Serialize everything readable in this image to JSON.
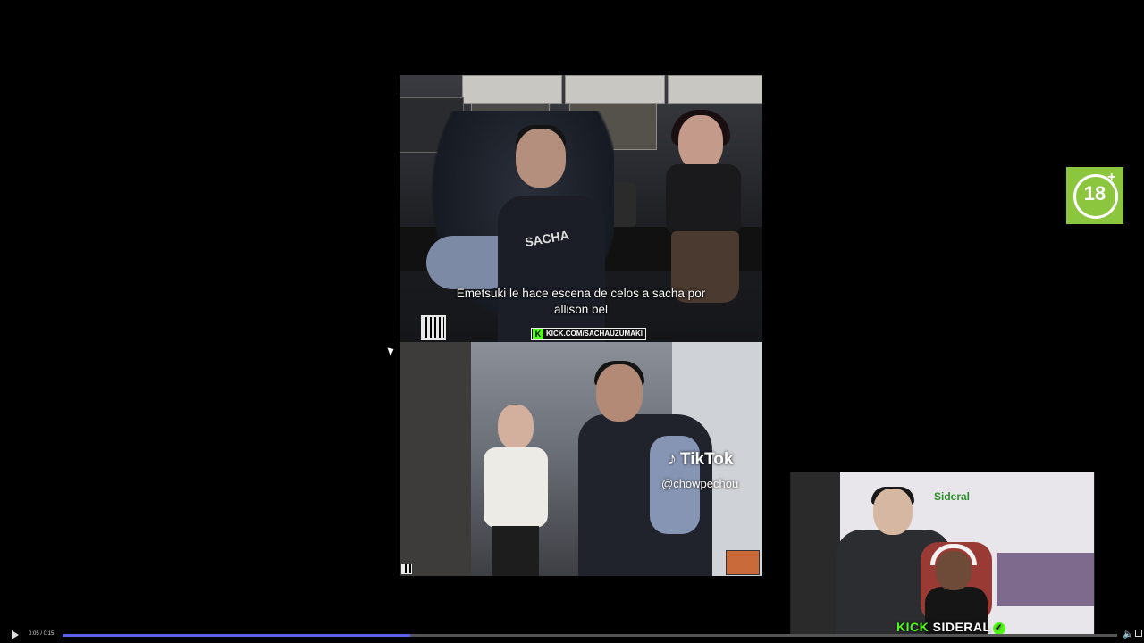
{
  "video": {
    "subtitle_line1": "Emetsuki le hace escena de celos a sacha por",
    "subtitle_line2": "allison bel",
    "kick_url": "KICK.COM/SACHAUZUMAKI",
    "tiktok_label": "TikTok",
    "tiktok_handle": "@chowpechou",
    "hoodie_text": "SACHA"
  },
  "webcam": {
    "banner_kick": "KICK",
    "banner_name": "SIDERAL",
    "wall_logo": "Sideral"
  },
  "age_badge": {
    "value": "18",
    "plus": "+"
  },
  "controls": {
    "time": "0:05 / 0:15",
    "progress": 0.33
  },
  "colors": {
    "kick_green": "#53fc18",
    "badge_green": "#8cc63f",
    "seek_fill": "#5a63e8"
  }
}
